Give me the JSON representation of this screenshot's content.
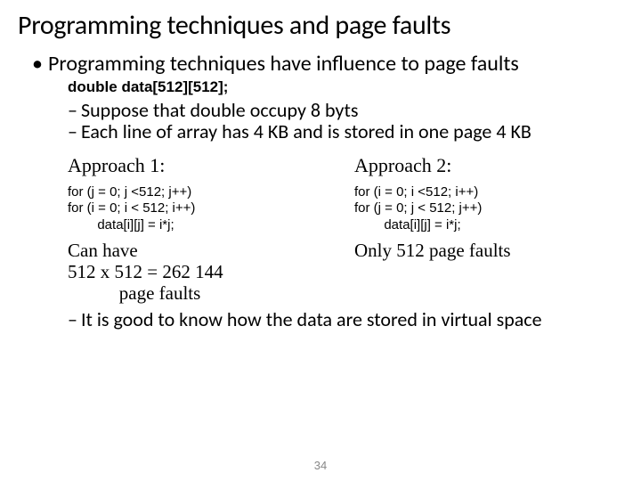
{
  "title": "Programming techniques and page faults",
  "bullet1": "Programming techniques have influence to page faults",
  "decl": "double data[512][512];",
  "dash1": "Suppose that double occupy 8 byts",
  "dash2": "Each line of array has 4 KB and is stored in one page 4 KB",
  "approach1": {
    "heading": "Approach 1:",
    "code": "for (j = 0; j <512; j++)\nfor (i = 0; i < 512; i++)\n        data[i][j] = i*j;",
    "result": "Can have\n512 x 512 = 262 144\n           page faults"
  },
  "approach2": {
    "heading": "Approach 2:",
    "code": "for (i = 0; i <512; i++)\nfor (j = 0; j < 512; j++)\n        data[i][j] = i*j;",
    "result": "Only 512 page faults"
  },
  "dash3": "It is good to know how the data are stored in virtual space",
  "pagenum": "34"
}
